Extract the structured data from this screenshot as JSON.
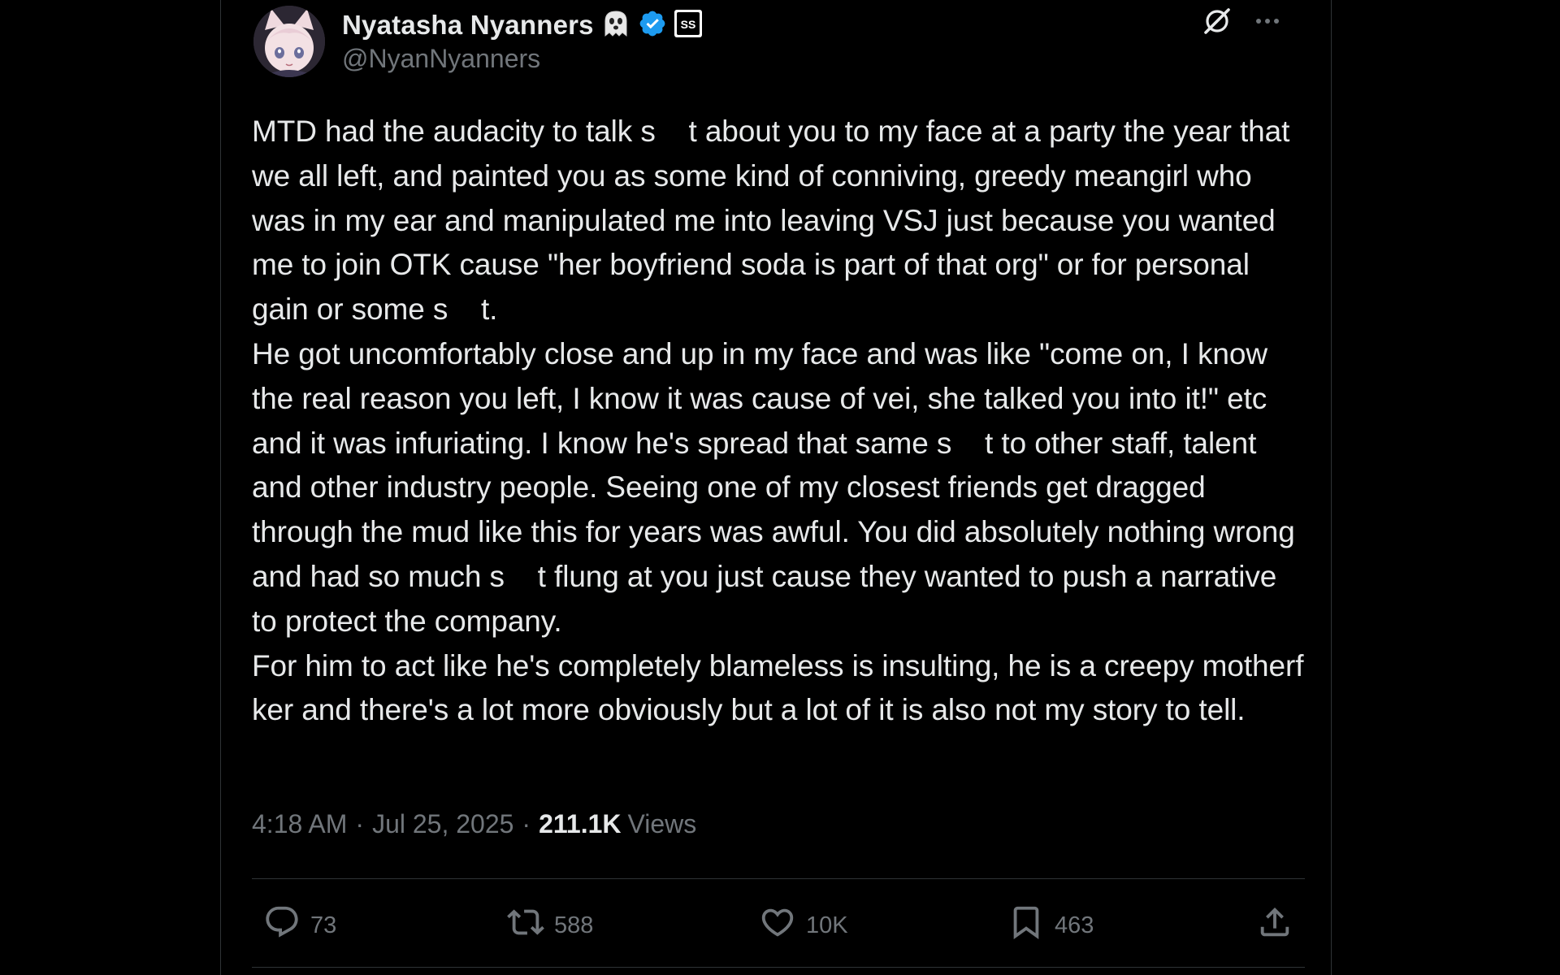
{
  "author": {
    "display_name": "Nyatasha Nyanners",
    "handle": "@NyanNyanners",
    "badges": [
      "ghost-emoji-icon",
      "verified-badge-icon",
      "affiliate-badge-icon"
    ],
    "verified_color": "#1d9bf0"
  },
  "header_actions": {
    "grok_icon": "grok-icon",
    "more_icon": "more-icon"
  },
  "post": {
    "text": "MTD had the audacity to talk s    t about you to my face at a party the year that we all left, and painted you as some kind of conniving, greedy meangirl who was in my ear and manipulated me into leaving VSJ just because you wanted me to join OTK cause \"her boyfriend soda is part of that org\" or for personal gain or some s    t.\nHe got uncomfortably close and up in my face and was like \"come on, I know the real reason you left, I know it was cause of vei, she talked you into it!\" etc and it was infuriating. I know he's spread that same s    t to other staff, talent and other industry people. Seeing one of my closest friends get dragged through the mud like this for years was awful. You did absolutely nothing wrong and had so much s    t flung at you just cause they wanted to push a narrative to protect the company.\nFor him to act like he's completely blameless is insulting, he is a creepy motherf     ker and there's a lot more obviously but a lot of it is also not my story to tell."
  },
  "meta": {
    "time": "4:18 AM",
    "separator": "·",
    "date": "Jul 25, 2025",
    "views_count": "211.1K",
    "views_label": "Views"
  },
  "actions": {
    "replies": "73",
    "reposts": "588",
    "likes": "10K",
    "bookmarks": "463"
  },
  "colors": {
    "background": "#000000",
    "text": "#e7e9ea",
    "secondary": "#71767b",
    "border": "#2f3336"
  }
}
